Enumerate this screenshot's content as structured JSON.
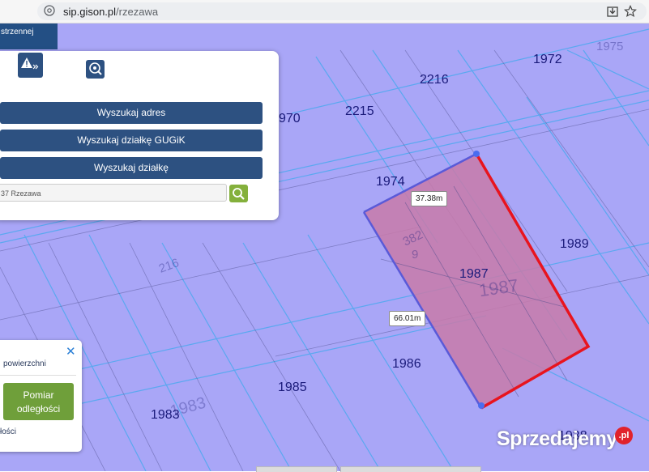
{
  "browser": {
    "url_host": "sip.gison.pl",
    "url_path": "/rzezawa",
    "icons": [
      "site-info-icon",
      "download-icon",
      "bookmark-star-icon"
    ]
  },
  "nav": {
    "tab_label": "strzennej"
  },
  "search_panel": {
    "buttons": [
      "Wyszukaj adres",
      "Wyszukaj działkę GUGiK",
      "Wyszukaj działkę"
    ],
    "search_value": "37 Rzezawa",
    "tool_icons": [
      "warning-expand-icon",
      "search-location-icon",
      "search-icon"
    ]
  },
  "measure_popup": {
    "label": "powierzchni",
    "button_label_line1": "Pomiar",
    "button_label_line2": "odległości",
    "footer_text": "łości"
  },
  "map": {
    "parcel_labels": [
      "1972",
      "2216",
      "2215",
      "970",
      "1974",
      "1989",
      "1987",
      "1986",
      "1985",
      "1983",
      "1938"
    ],
    "faint_labels": [
      "1975",
      "382",
      "9",
      "1987",
      "216",
      "1983"
    ],
    "measurements": [
      "37.38m",
      "66.01m"
    ],
    "colors": {
      "map_fill": "#a9a6f7",
      "parcel_fill": "#c87aa9",
      "parcel_outline": "#e8141e"
    }
  },
  "watermark": {
    "text": "Sprzedajemy",
    "badge": ".pl"
  }
}
